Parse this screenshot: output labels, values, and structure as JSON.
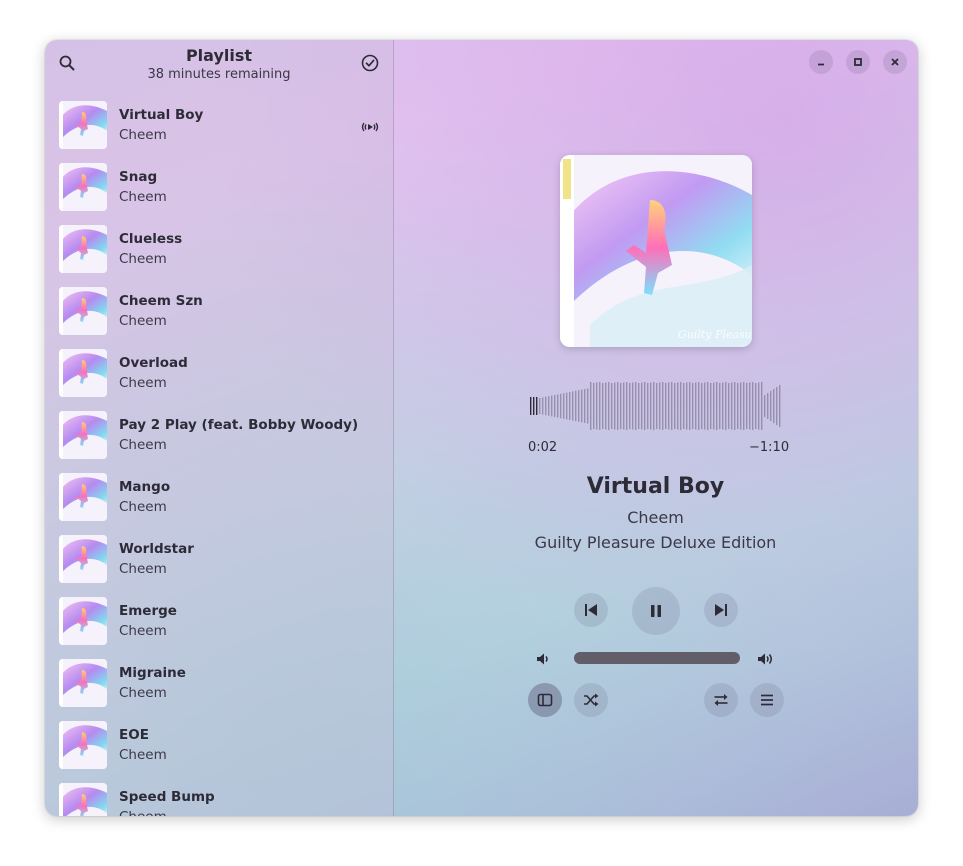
{
  "sidebar": {
    "title": "Playlist",
    "subtitle": "38 minutes remaining",
    "search_icon": "search-icon",
    "select_icon": "check-circle-icon"
  },
  "tracks": [
    {
      "title": "Virtual Boy",
      "artist": "Cheem",
      "playing": true
    },
    {
      "title": "Snag",
      "artist": "Cheem"
    },
    {
      "title": "Clueless",
      "artist": "Cheem"
    },
    {
      "title": "Cheem Szn",
      "artist": "Cheem"
    },
    {
      "title": "Overload",
      "artist": "Cheem"
    },
    {
      "title": "Pay 2 Play (feat. Bobby Woody)",
      "artist": "Cheem"
    },
    {
      "title": "Mango",
      "artist": "Cheem"
    },
    {
      "title": "Worldstar",
      "artist": "Cheem"
    },
    {
      "title": "Emerge",
      "artist": "Cheem"
    },
    {
      "title": "Migraine",
      "artist": "Cheem"
    },
    {
      "title": "EOE",
      "artist": "Cheem"
    },
    {
      "title": "Speed Bump",
      "artist": "Cheem"
    }
  ],
  "window_controls": {
    "minimize": "minimize-icon",
    "maximize": "maximize-icon",
    "close": "close-icon"
  },
  "now_playing": {
    "title": "Virtual Boy",
    "artist": "Cheem",
    "album": "Guilty Pleasure Deluxe Edition",
    "elapsed": "0:02",
    "remaining": "−1:10",
    "progress": 0.03
  },
  "controls": {
    "previous": "skip-back-icon",
    "play_pause": "pause-icon",
    "next": "skip-forward-icon",
    "volume_low": "volume-low-icon",
    "volume_high": "volume-high-icon",
    "volume_level": 1.0,
    "sidebar_toggle": "sidebar-icon",
    "shuffle": "shuffle-icon",
    "repeat": "repeat-icon",
    "menu": "menu-icon"
  }
}
